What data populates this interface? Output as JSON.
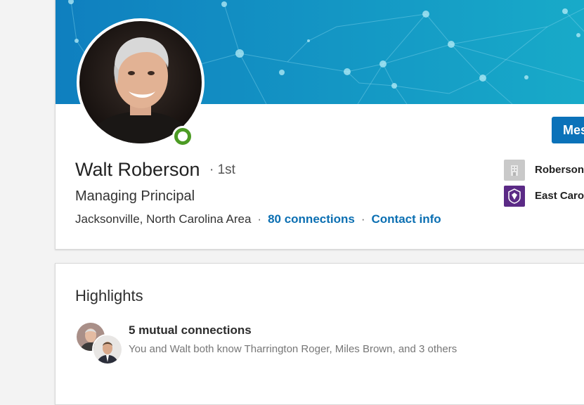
{
  "profile": {
    "name": "Walt Roberson",
    "degree": "· 1st",
    "headline": "Managing Principal",
    "location": "Jacksonville, North Carolina Area",
    "separator": "·",
    "connections": "80 connections",
    "contact_info": "Contact info",
    "message_label": "Mes",
    "presence": "online"
  },
  "experience_summary": [
    {
      "label": "Roberson",
      "icon": "company-building-icon"
    },
    {
      "label": "East Caro",
      "icon": "school-crest-icon"
    }
  ],
  "highlights": {
    "title": "Highlights",
    "mutual_title": "5 mutual connections",
    "mutual_subtitle": "You and Walt both know Tharrington Roger, Miles Brown, and 3 others"
  },
  "colors": {
    "brand_blue": "#0b72b9",
    "link_blue": "#0b6fb2",
    "online_green": "#4c9b24",
    "banner_start": "#0f7fbf",
    "banner_end": "#17a9c9",
    "school_purple": "#5b2a86"
  }
}
